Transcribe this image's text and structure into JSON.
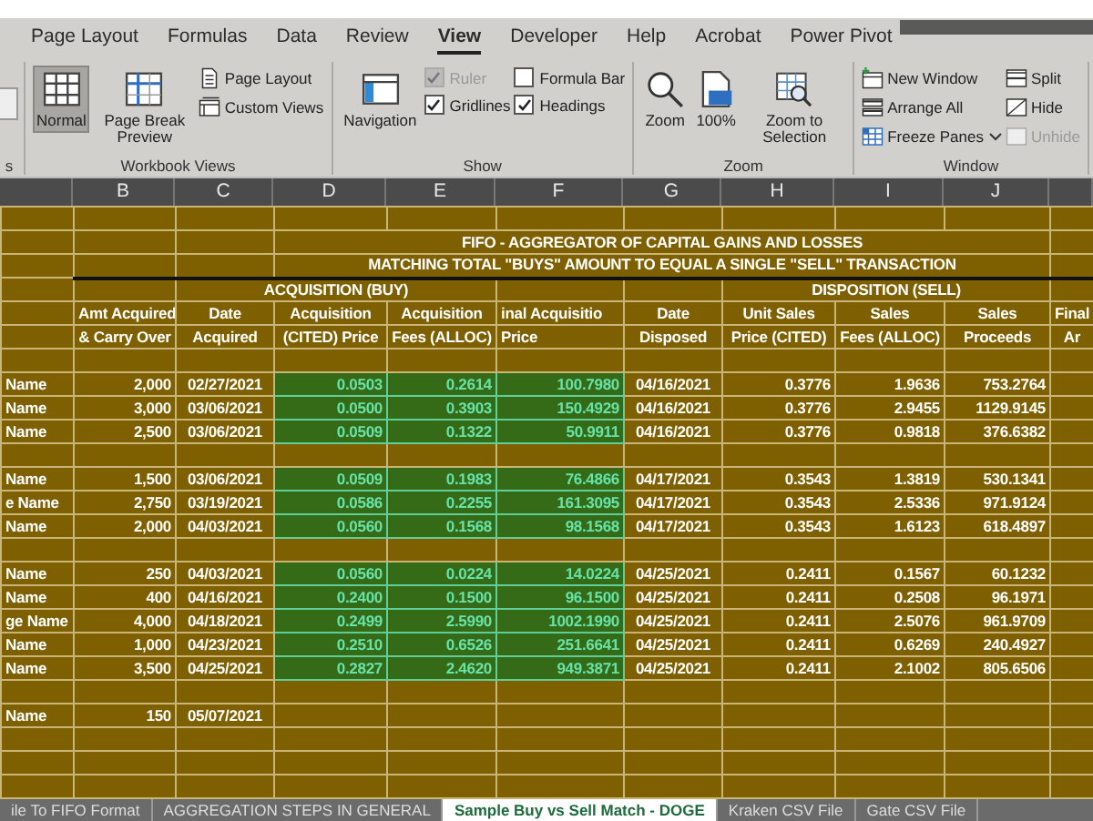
{
  "ribbon_tabs": [
    {
      "label": "Page Layout",
      "selected": false
    },
    {
      "label": "Formulas",
      "selected": false
    },
    {
      "label": "Data",
      "selected": false
    },
    {
      "label": "Review",
      "selected": false
    },
    {
      "label": "View",
      "selected": true
    },
    {
      "label": "Developer",
      "selected": false
    },
    {
      "label": "Help",
      "selected": false
    },
    {
      "label": "Acrobat",
      "selected": false
    },
    {
      "label": "Power Pivot",
      "selected": false
    }
  ],
  "partial_group": {
    "label": "s"
  },
  "ribbon_groups": [
    {
      "label": "Workbook Views",
      "columns": [
        [
          {
            "kind": "large",
            "label": "Normal",
            "selected": true,
            "disabled": false
          }
        ],
        [
          {
            "kind": "large",
            "label": "Page Break Preview",
            "selected": false,
            "disabled": false
          }
        ],
        [
          {
            "kind": "small",
            "label": "Page Layout",
            "disabled": false
          },
          {
            "kind": "small",
            "label": "Custom Views",
            "disabled": false
          }
        ]
      ]
    },
    {
      "label": "Show",
      "columns": [
        [
          {
            "kind": "large",
            "label": "Navigation",
            "selected": false,
            "disabled": false
          }
        ],
        [
          {
            "kind": "check",
            "label": "Ruler",
            "checked": true,
            "disabled": true
          },
          {
            "kind": "check",
            "label": "Gridlines",
            "checked": true,
            "disabled": false
          }
        ],
        [
          {
            "kind": "check",
            "label": "Formula Bar",
            "checked": false,
            "disabled": false
          },
          {
            "kind": "check",
            "label": "Headings",
            "checked": true,
            "disabled": false
          }
        ]
      ]
    },
    {
      "label": "Zoom",
      "columns": [
        [
          {
            "kind": "large",
            "label": "Zoom",
            "selected": false,
            "disabled": false
          }
        ],
        [
          {
            "kind": "large",
            "label": "100%",
            "selected": false,
            "disabled": false
          }
        ],
        [
          {
            "kind": "large",
            "label": "Zoom to Selection",
            "selected": false,
            "disabled": false
          }
        ]
      ]
    },
    {
      "label": "Window",
      "columns": [
        [
          {
            "kind": "small",
            "label": "New Window",
            "disabled": false
          },
          {
            "kind": "small",
            "label": "Arrange All",
            "disabled": false
          },
          {
            "kind": "menu",
            "label": "Freeze Panes",
            "disabled": false
          }
        ],
        [
          {
            "kind": "small",
            "label": "Split",
            "disabled": false
          },
          {
            "kind": "small",
            "label": "Hide",
            "disabled": false
          },
          {
            "kind": "small",
            "label": "Unhide",
            "disabled": true
          }
        ]
      ]
    }
  ],
  "sheet": {
    "column_headers": [
      "B",
      "C",
      "D",
      "E",
      "F",
      "G",
      "H",
      "I",
      "J"
    ],
    "rows": [
      {
        "kind": "blank"
      },
      {
        "kind": "title",
        "text": "FIFO - AGGREGATOR OF CAPITAL GAINS AND LOSSES",
        "thick_rule": false
      },
      {
        "kind": "title",
        "text": "MATCHING TOTAL \"BUYS\" AMOUNT TO EQUAL A SINGLE \"SELL\" TRANSACTION",
        "thick_rule": true
      },
      {
        "kind": "section",
        "acquisition": "ACQUISITION (BUY)",
        "disposition": "DISPOSITION (SELL)"
      },
      {
        "kind": "header",
        "cells": [
          "Amt Acquired",
          "Date",
          "Acquisition",
          "Acquisition",
          "inal Acquisitio",
          "Date",
          "Unit Sales",
          "Sales",
          "Sales",
          "Final"
        ]
      },
      {
        "kind": "header",
        "cells": [
          "& Carry Over",
          "Acquired",
          "(CITED) Price",
          "Fees (ALLOC)",
          "Price",
          "Disposed",
          "Price (CITED)",
          "Fees (ALLOC)",
          "Proceeds",
          "Ar"
        ]
      },
      {
        "kind": "blank"
      },
      {
        "kind": "data",
        "name": "Name",
        "amount": "2,000",
        "date_acquired": "02/27/2021",
        "price": "0.0503",
        "fees": "0.2614",
        "final_price": "100.7980",
        "date_disposed": "04/16/2021",
        "unit_price": "0.3776",
        "sales_fees": "1.9636",
        "proceeds": "753.2764",
        "highlighted": true
      },
      {
        "kind": "data",
        "name": "Name",
        "amount": "3,000",
        "date_acquired": "03/06/2021",
        "price": "0.0500",
        "fees": "0.3903",
        "final_price": "150.4929",
        "date_disposed": "04/16/2021",
        "unit_price": "0.3776",
        "sales_fees": "2.9455",
        "proceeds": "1129.9145",
        "highlighted": true
      },
      {
        "kind": "data",
        "name": "Name",
        "amount": "2,500",
        "date_acquired": "03/06/2021",
        "price": "0.0509",
        "fees": "0.1322",
        "final_price": "50.9911",
        "date_disposed": "04/16/2021",
        "unit_price": "0.3776",
        "sales_fees": "0.9818",
        "proceeds": "376.6382",
        "highlighted": true
      },
      {
        "kind": "blank"
      },
      {
        "kind": "data",
        "name": "Name",
        "amount": "1,500",
        "date_acquired": "03/06/2021",
        "price": "0.0509",
        "fees": "0.1983",
        "final_price": "76.4866",
        "date_disposed": "04/17/2021",
        "unit_price": "0.3543",
        "sales_fees": "1.3819",
        "proceeds": "530.1341",
        "highlighted": true
      },
      {
        "kind": "data",
        "name": "e Name",
        "amount": "2,750",
        "date_acquired": "03/19/2021",
        "price": "0.0586",
        "fees": "0.2255",
        "final_price": "161.3095",
        "date_disposed": "04/17/2021",
        "unit_price": "0.3543",
        "sales_fees": "2.5336",
        "proceeds": "971.9124",
        "highlighted": true
      },
      {
        "kind": "data",
        "name": "Name",
        "amount": "2,000",
        "date_acquired": "04/03/2021",
        "price": "0.0560",
        "fees": "0.1568",
        "final_price": "98.1568",
        "date_disposed": "04/17/2021",
        "unit_price": "0.3543",
        "sales_fees": "1.6123",
        "proceeds": "618.4897",
        "highlighted": true
      },
      {
        "kind": "blank"
      },
      {
        "kind": "data",
        "name": "Name",
        "amount": "250",
        "date_acquired": "04/03/2021",
        "price": "0.0560",
        "fees": "0.0224",
        "final_price": "14.0224",
        "date_disposed": "04/25/2021",
        "unit_price": "0.2411",
        "sales_fees": "0.1567",
        "proceeds": "60.1232",
        "highlighted": true
      },
      {
        "kind": "data",
        "name": "Name",
        "amount": "400",
        "date_acquired": "04/16/2021",
        "price": "0.2400",
        "fees": "0.1500",
        "final_price": "96.1500",
        "date_disposed": "04/25/2021",
        "unit_price": "0.2411",
        "sales_fees": "0.2508",
        "proceeds": "96.1971",
        "highlighted": true
      },
      {
        "kind": "data",
        "name": "ge Name",
        "amount": "4,000",
        "date_acquired": "04/18/2021",
        "price": "0.2499",
        "fees": "2.5990",
        "final_price": "1002.1990",
        "date_disposed": "04/25/2021",
        "unit_price": "0.2411",
        "sales_fees": "2.5076",
        "proceeds": "961.9709",
        "highlighted": true
      },
      {
        "kind": "data",
        "name": "Name",
        "amount": "1,000",
        "date_acquired": "04/23/2021",
        "price": "0.2510",
        "fees": "0.6526",
        "final_price": "251.6641",
        "date_disposed": "04/25/2021",
        "unit_price": "0.2411",
        "sales_fees": "0.6269",
        "proceeds": "240.4927",
        "highlighted": true
      },
      {
        "kind": "data",
        "name": "Name",
        "amount": "3,500",
        "date_acquired": "04/25/2021",
        "price": "0.2827",
        "fees": "2.4620",
        "final_price": "949.3871",
        "date_disposed": "04/25/2021",
        "unit_price": "0.2411",
        "sales_fees": "2.1002",
        "proceeds": "805.6506",
        "highlighted": true
      },
      {
        "kind": "blank"
      },
      {
        "kind": "data",
        "name": "Name",
        "amount": "150",
        "date_acquired": "05/07/2021",
        "highlighted": false
      },
      {
        "kind": "blank"
      },
      {
        "kind": "blank"
      },
      {
        "kind": "blank"
      }
    ]
  },
  "sheet_tabs": [
    {
      "label": "ile To FIFO Format",
      "selected": false
    },
    {
      "label": "AGGREGATION STEPS IN GENERAL",
      "selected": false
    },
    {
      "label": "Sample Buy vs Sell Match - DOGE",
      "selected": true
    },
    {
      "label": "Kraken CSV File",
      "selected": false
    },
    {
      "label": "Gate CSV File",
      "selected": false
    }
  ]
}
